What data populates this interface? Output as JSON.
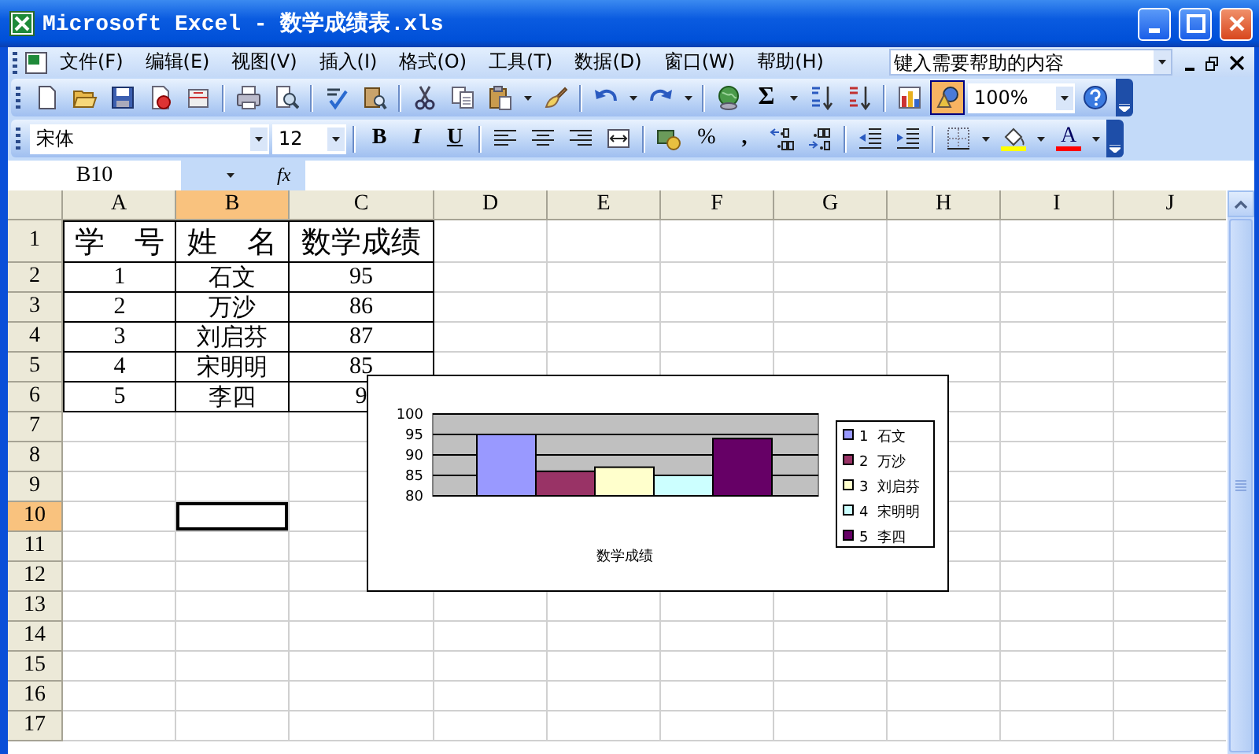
{
  "window": {
    "title": "Microsoft Excel - 数学成绩表.xls"
  },
  "menu": [
    {
      "label": "文件(F)"
    },
    {
      "label": "编辑(E)"
    },
    {
      "label": "视图(V)"
    },
    {
      "label": "插入(I)"
    },
    {
      "label": "格式(O)"
    },
    {
      "label": "工具(T)"
    },
    {
      "label": "数据(D)"
    },
    {
      "label": "窗口(W)"
    },
    {
      "label": "帮助(H)"
    }
  ],
  "help_box": {
    "placeholder": "键入需要帮助的内容"
  },
  "standard_toolbar": {
    "sum": "Σ",
    "zoom": "100%"
  },
  "formatting_toolbar": {
    "font": "宋体",
    "size": "12",
    "bold": "B",
    "italic": "I",
    "underline": "U",
    "percent": "%",
    "comma": ",",
    "font_color": "A"
  },
  "formula_bar": {
    "name_box": "B10",
    "function_label": "fx"
  },
  "sheet": {
    "columns": [
      {
        "label": "A",
        "selected": false
      },
      {
        "label": "B",
        "selected": true
      },
      {
        "label": "C",
        "selected": false
      },
      {
        "label": "D",
        "selected": false
      },
      {
        "label": "E",
        "selected": false
      },
      {
        "label": "F",
        "selected": false
      },
      {
        "label": "G",
        "selected": false
      },
      {
        "label": "H",
        "selected": false
      },
      {
        "label": "I",
        "selected": false
      },
      {
        "label": "J",
        "selected": false
      }
    ],
    "rows": [
      {
        "label": "1",
        "selected": false,
        "cells": [
          "学　号",
          "姓　名",
          "数学成绩"
        ]
      },
      {
        "label": "2",
        "selected": false,
        "cells": [
          "1",
          "石文",
          "95"
        ]
      },
      {
        "label": "3",
        "selected": false,
        "cells": [
          "2",
          "万沙",
          "86"
        ]
      },
      {
        "label": "4",
        "selected": false,
        "cells": [
          "3",
          "刘启芬",
          "87"
        ]
      },
      {
        "label": "5",
        "selected": false,
        "cells": [
          "4",
          "宋明明",
          "85"
        ]
      },
      {
        "label": "6",
        "selected": false,
        "cells": [
          "5",
          "李四",
          "9"
        ]
      },
      {
        "label": "7",
        "selected": false
      },
      {
        "label": "8",
        "selected": false
      },
      {
        "label": "9",
        "selected": false
      },
      {
        "label": "10",
        "selected": true
      },
      {
        "label": "11",
        "selected": false
      },
      {
        "label": "12",
        "selected": false
      },
      {
        "label": "13",
        "selected": false
      },
      {
        "label": "14",
        "selected": false
      },
      {
        "label": "15",
        "selected": false
      },
      {
        "label": "16",
        "selected": false
      },
      {
        "label": "17",
        "selected": false
      }
    ]
  },
  "chart": {
    "chart_data": {
      "type": "bar",
      "xlabel": "数学成绩",
      "categories": [
        null
      ],
      "grid": true,
      "legend": "right",
      "ylim": [
        80,
        100
      ],
      "yticks": [
        80,
        85,
        90,
        95,
        100
      ],
      "series": [
        {
          "name": "1  石文",
          "color": "#9999ff",
          "values": [
            95
          ]
        },
        {
          "name": "2  万沙",
          "color": "#993366",
          "values": [
            86
          ]
        },
        {
          "name": "3  刘启芬",
          "color": "#ffffcc",
          "values": [
            87
          ]
        },
        {
          "name": "4  宋明明",
          "color": "#ccffff",
          "values": [
            85
          ]
        },
        {
          "name": "5  李四",
          "color": "#660066",
          "values": [
            94
          ]
        }
      ]
    }
  }
}
